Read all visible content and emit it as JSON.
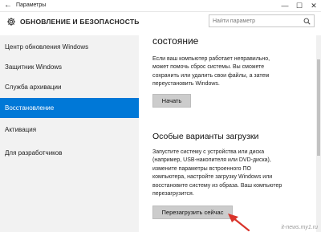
{
  "window": {
    "title": "Параметры",
    "back_icon": "arrow-left-icon",
    "minimize_glyph": "—",
    "maximize_glyph": "☐",
    "close_glyph": "✕"
  },
  "header": {
    "title": "ОБНОВЛЕНИЕ И БЕЗОПАСНОСТЬ",
    "icon": "gear-icon",
    "search_placeholder": "Найти параметр"
  },
  "sidebar": {
    "items": [
      {
        "label": "Центр обновления Windows",
        "active": false
      },
      {
        "label": "Защитник Windows",
        "active": false
      },
      {
        "label": "Служба архивации",
        "active": false
      },
      {
        "label": "Восстановление",
        "active": true
      },
      {
        "label": "Активация",
        "active": false
      },
      {
        "label": "Для разработчиков",
        "active": false
      }
    ]
  },
  "main": {
    "reset_section": {
      "title_fragment": "состояние",
      "lines": [
        "Если ваш компьютер работает неправильно,",
        "может помочь сброс системы. Вы сможете",
        "сохранить или удалить свои файлы, а затем",
        "переустановить Windows."
      ],
      "button_label": "Начать"
    },
    "boot_section": {
      "title": "Особые варианты загрузки",
      "lines": [
        "Запустите систему с устройства или диска",
        "(например, USB-накопителя или DVD-диска),",
        "измените параметры встроенного ПО",
        "компьютера, настройте загрузку Windows или",
        "восстановите систему из образа. Ваш компьютер",
        "перезагрузится."
      ],
      "button_label": "Перезагрузить сейчас"
    }
  },
  "watermark": "it-news.my1.ru",
  "colors": {
    "accent": "#0078d7",
    "sidebar_bg": "#f2f2f2",
    "button_bg": "#cccccc",
    "arrow": "#d9342b"
  }
}
